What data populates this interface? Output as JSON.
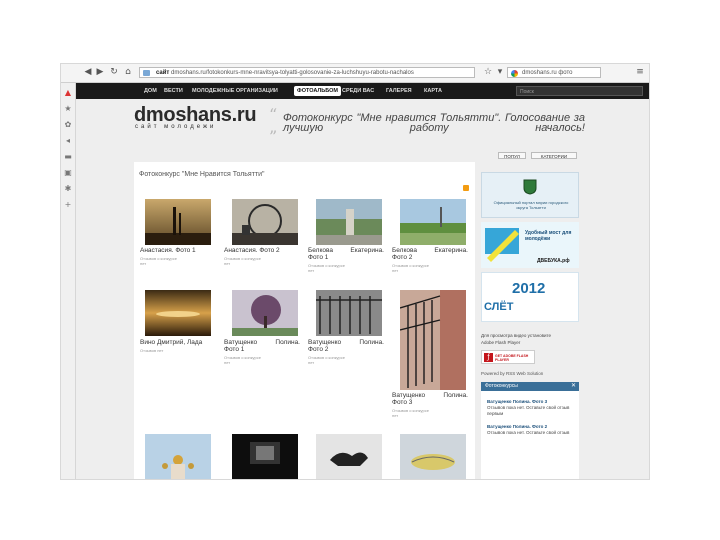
{
  "browser": {
    "url_domain": "dmoshans.ru",
    "url_text": "dmoshans.ru/fotokonkurs-mne-nravitsya-tolyatti-golosovanie-za-luchshuyu-rabotu-nachalos",
    "tab_label": "сайт",
    "search_text": "dmoshans.ru фото"
  },
  "site": {
    "logo_title": "dmoshans.ru",
    "logo_subtitle": "сайт молодежи",
    "search_placeholder": "Поиск",
    "nav": [
      "ДОМ",
      "ВЕСТИ",
      "МОЛОДЕЖНЫЕ ОРГАНИЗАЦИИ",
      "ФОТОАЛЬБОМ",
      "СРЕДИ ВАС",
      "ГАЛЕРЕЯ",
      "КАРТА"
    ],
    "quote": "Фотоконкурс \"Мне нравится Тольятти\". Голосование за лучшую работу началось!",
    "header_tabs": [
      "ПОПУЛ",
      "КАТЕГОРИИ"
    ]
  },
  "content": {
    "title": "Фотоконкурс \"Мне Нравится Тольятти\"",
    "photos": [
      {
        "caption": "Анастасия. Фото 1",
        "meta": "Отзывов о конкурсе нет"
      },
      {
        "caption": "Анастасия. Фото 2",
        "meta": "Отзывов о конкурсе нет"
      },
      {
        "caption": "Белкова Екатерина. Фото 1",
        "meta": "Отзывов о конкурсе нет"
      },
      {
        "caption": "Белкова Екатерина. Фото 2",
        "meta": "Отзывов о конкурсе нет"
      },
      {
        "caption": "Вино Дмитрий, Лада",
        "meta": "Отзывов нет"
      },
      {
        "caption": "Ватущенко Полина. Фото 1",
        "meta": "Отзывов о конкурсе нет"
      },
      {
        "caption": "Ватущенко Полина. Фото 2",
        "meta": "Отзывов о конкурсе нет"
      },
      {
        "caption": "Ватущенко Полина. Фото 3",
        "meta": "Отзывов о конкурсе нет"
      }
    ]
  },
  "rightbar": {
    "ad1_text": "Официальный портал мэрии городского округа Тольятти",
    "ad2_text": "Удобный мост для молодёжи",
    "ad2_domain": "ДВЕБУКА.рф",
    "ad3_year": "2012",
    "ad3_word": "СЛЁТ",
    "flash_line1": "Для просмотра видео установите",
    "flash_line2": "Adobe Flash Player",
    "flash_badge": "GET ADOBE FLASH PLAYER",
    "powered": "Powered by RSS Web Solution",
    "widget_title": "Фотоконкурсы",
    "news": [
      {
        "title": "Ватущенко Полина. Фото 3",
        "text": "Отзывов пока нет. Оставьте свой отзыв первым"
      },
      {
        "title": "Ватущенко Полина. Фото 2",
        "text": "Отзывов пока нет. Оставьте свой отзыв"
      }
    ]
  }
}
